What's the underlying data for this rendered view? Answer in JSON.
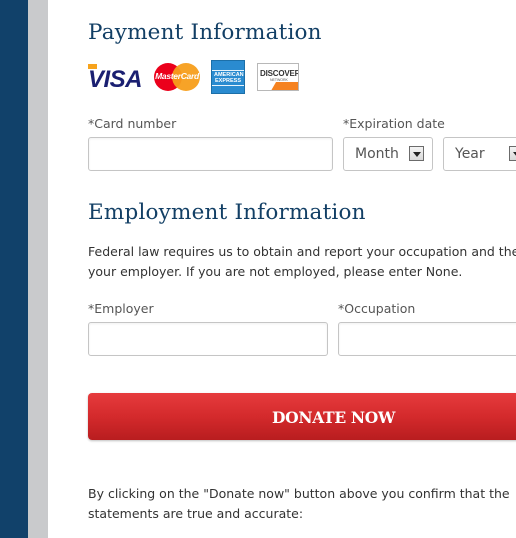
{
  "payment": {
    "title": "Payment Information",
    "cards": {
      "visa": "VISA",
      "mastercard": "MasterCard",
      "amex": "AMERICAN EXPRESS",
      "discover": "DISCOVER",
      "discover_sub": "NETWORK"
    },
    "card_number_label": "*Card number",
    "card_number_value": "",
    "expiration_label": "*Expiration date",
    "month_value": "Month",
    "year_value": "Year"
  },
  "employment": {
    "title": "Employment Information",
    "description_line1": "Federal law requires us to obtain and report your occupation and the",
    "description_line2": "your employer. If you are not employed, please enter None.",
    "employer_label": "*Employer",
    "employer_value": "",
    "occupation_label": "*Occupation",
    "occupation_value": ""
  },
  "donate_button_label": "DONATE NOW",
  "footer": {
    "line1": "By clicking on the \"Donate now\" button above you confirm that the",
    "line2": "statements are true and accurate:"
  },
  "colors": {
    "sidebar_dark": "#11416a",
    "sidebar_gray": "#c9cacc",
    "heading": "#123f65",
    "donate_red": "#d42a2c"
  }
}
